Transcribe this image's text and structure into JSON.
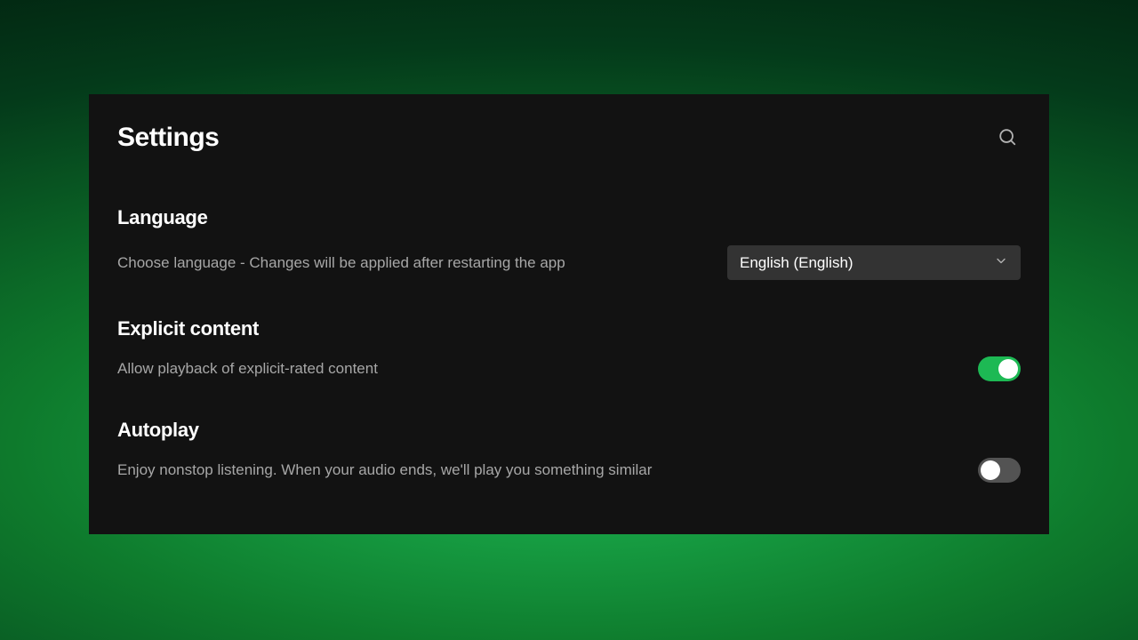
{
  "title": "Settings",
  "sections": {
    "language": {
      "title": "Language",
      "description": "Choose language - Changes will be applied after restarting the app",
      "selected": "English (English)"
    },
    "explicit": {
      "title": "Explicit content",
      "description": "Allow playback of explicit-rated content",
      "toggle": true
    },
    "autoplay": {
      "title": "Autoplay",
      "description": "Enjoy nonstop listening. When your audio ends, we'll play you something similar",
      "toggle": false
    }
  },
  "colors": {
    "accent": "#1DB954",
    "panel": "#121212",
    "text": "#ffffff",
    "muted": "#a7a7a7"
  }
}
